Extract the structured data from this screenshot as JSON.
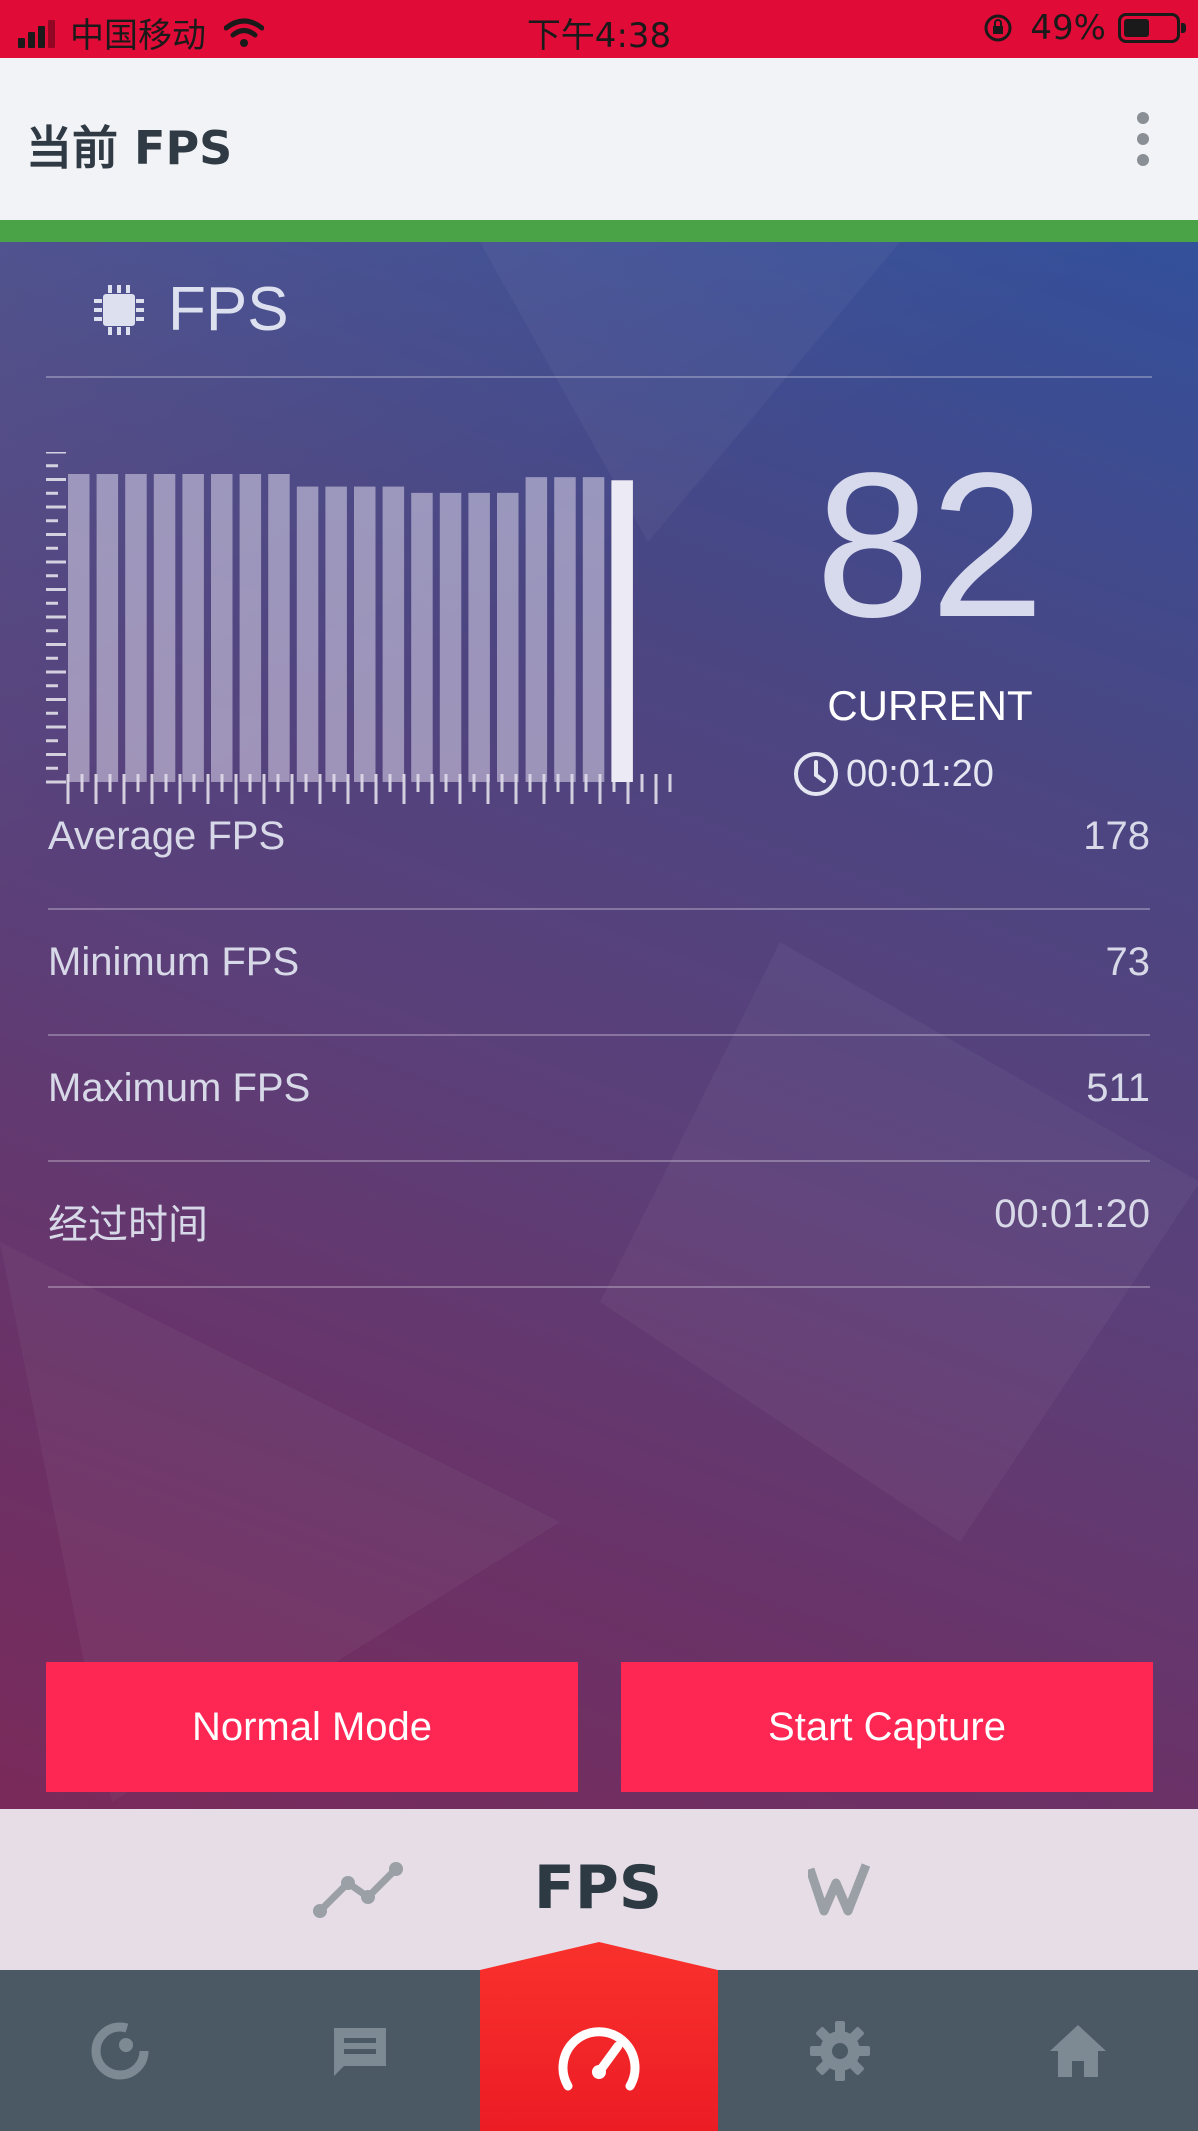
{
  "status_bar": {
    "carrier": "中国移动",
    "time": "下午4:38",
    "battery": "49%",
    "battery_level": 0.49
  },
  "app_bar": {
    "title": "当前 FPS"
  },
  "fps_panel": {
    "title": "FPS",
    "current_value": "82",
    "current_label": "CURRENT",
    "timer": "00:01:20"
  },
  "stats": [
    {
      "label": "Average FPS",
      "value": "178"
    },
    {
      "label": "Minimum FPS",
      "value": "73"
    },
    {
      "label": "Maximum FPS",
      "value": "511"
    },
    {
      "label": "经过时间",
      "value": "00:01:20"
    }
  ],
  "buttons": {
    "normal_mode": "Normal Mode",
    "start_capture": "Start Capture"
  },
  "sub_tabs": {
    "active": "FPS"
  },
  "chart_data": {
    "type": "bar",
    "values": [
      98,
      98,
      98,
      98,
      98,
      98,
      98,
      98,
      94,
      94,
      94,
      94,
      92,
      92,
      92,
      92,
      97,
      97,
      97,
      96
    ],
    "ylim": [
      0,
      105
    ],
    "highlight_last": true
  },
  "colors": {
    "status_bar": "#e10b37",
    "accent_green": "#4aa447",
    "button_red": "#fe2653",
    "nav_active": "#ec1c25",
    "nav_bg": "#4a5964"
  }
}
